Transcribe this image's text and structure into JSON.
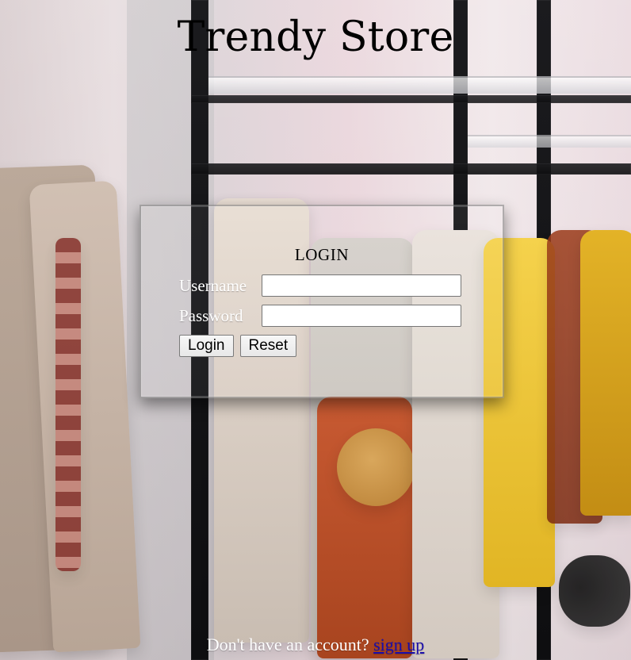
{
  "header": {
    "title": "Trendy Store"
  },
  "login": {
    "heading": "LOGIN",
    "username_label": "Username",
    "username_value": "",
    "password_label": "Password",
    "password_value": "",
    "login_button": "Login",
    "reset_button": "Reset"
  },
  "footer": {
    "prompt": "Don't have an account?",
    "signup_link": "sign up"
  },
  "colors": {
    "title_text": "#000000",
    "label_text": "#ffffff",
    "link": "#1a0dab",
    "page_bg_tint": "#f1d7df",
    "panel_border": "#787878"
  },
  "icons": []
}
